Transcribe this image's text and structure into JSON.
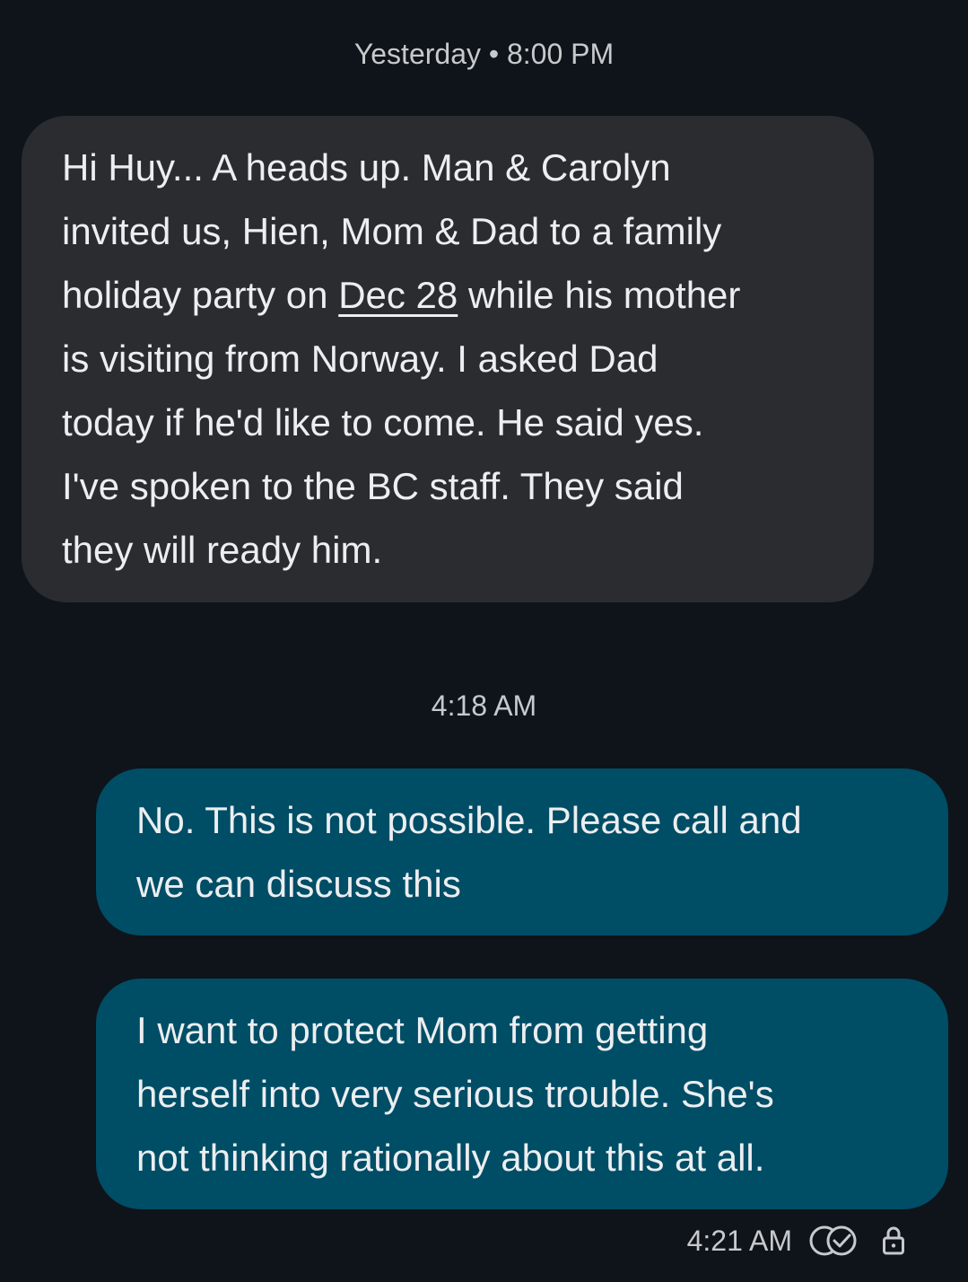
{
  "thread": {
    "timestamp_1": "Yesterday • 8:00 PM",
    "timestamp_2": "4:18 AM"
  },
  "messages": {
    "incoming_1": {
      "line_1": "Hi Huy... A heads up. Man & Carolyn",
      "line_2": "invited us, Hien, Mom & Dad to a family",
      "line_3_pre": "holiday party on ",
      "line_3_link": "Dec 28",
      "line_3_post": " while his mother",
      "line_4": "is visiting from Norway. I asked Dad",
      "line_5": "today if he'd like to come. He said yes.",
      "line_6": "I've spoken to the BC staff. They said",
      "line_7": "they will ready him."
    },
    "outgoing_1": {
      "line_1": "No. This is not possible. Please call and",
      "line_2": "we can discuss this"
    },
    "outgoing_2": {
      "line_1": "I want to protect Mom from getting",
      "line_2": "herself into very serious trouble. She's",
      "line_3": "not thinking rationally about this at all."
    }
  },
  "status": {
    "time": "4:21 AM",
    "read_icon": "double-check-icon",
    "lock_icon": "lock-icon"
  },
  "colors": {
    "background": "#0f141a",
    "incoming_bubble": "#2a2c2f",
    "outgoing_bubble": "#004d66",
    "text": "#eceef0",
    "meta_text": "#c7cacd"
  }
}
